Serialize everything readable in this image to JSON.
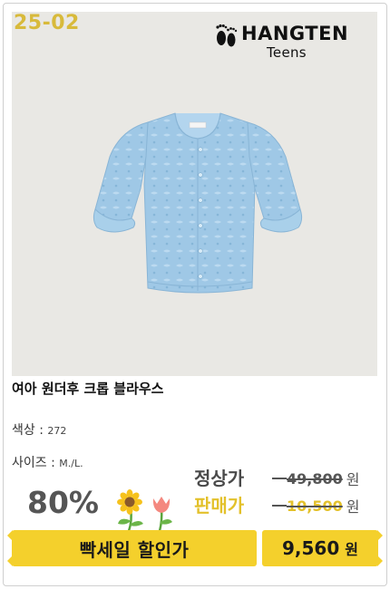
{
  "product": {
    "code": "25-02",
    "brand": "HANGTEN",
    "brand_sub": "Teens",
    "title": "여아 원더후 크롭 블라우스",
    "color_label": "색상 : ",
    "color_value": "272",
    "size_label": "사이즈 : ",
    "size_value": "M./L."
  },
  "promo": {
    "discount": "80%",
    "regular_label": "정상가",
    "regular_price": "49,800",
    "sale_label": "판매가",
    "sale_price": "10,500",
    "won": "원",
    "flash_label": "빡세일 할인가",
    "flash_price": "9,560",
    "flash_won": "원"
  },
  "colors": {
    "accent_yellow": "#f4d02c",
    "code_yellow": "#d8ba3b",
    "shirt_blue": "#9fc8e6",
    "photo_bg": "#e9e8e4"
  },
  "icons": [
    "hangten-feet-logo-icon",
    "sunflower-tulip-icon"
  ]
}
